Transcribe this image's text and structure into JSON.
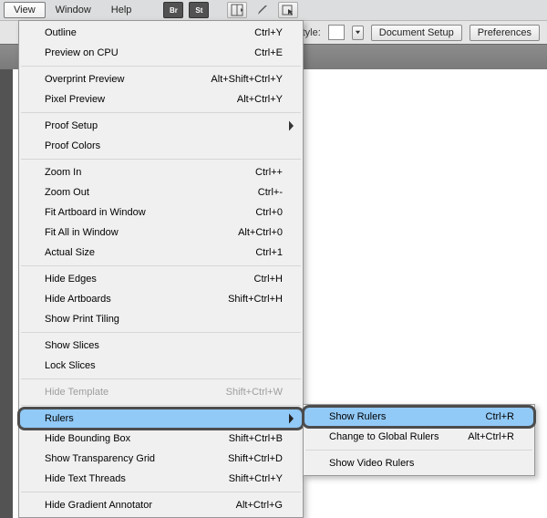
{
  "menubar": {
    "view": "View",
    "window": "Window",
    "help": "Help"
  },
  "second_bar": {
    "style_label": "Style:",
    "doc_setup": "Document Setup",
    "preferences": "Preferences"
  },
  "view_menu": {
    "outline": {
      "label": "Outline",
      "accel": "Ctrl+Y"
    },
    "preview_cpu": {
      "label": "Preview on CPU",
      "accel": "Ctrl+E"
    },
    "overprint_preview": {
      "label": "Overprint Preview",
      "accel": "Alt+Shift+Ctrl+Y"
    },
    "pixel_preview": {
      "label": "Pixel Preview",
      "accel": "Alt+Ctrl+Y"
    },
    "proof_setup": {
      "label": "Proof Setup",
      "accel": ""
    },
    "proof_colors": {
      "label": "Proof Colors",
      "accel": ""
    },
    "zoom_in": {
      "label": "Zoom In",
      "accel": "Ctrl++"
    },
    "zoom_out": {
      "label": "Zoom Out",
      "accel": "Ctrl+-"
    },
    "fit_artboard": {
      "label": "Fit Artboard in Window",
      "accel": "Ctrl+0"
    },
    "fit_all": {
      "label": "Fit All in Window",
      "accel": "Alt+Ctrl+0"
    },
    "actual_size": {
      "label": "Actual Size",
      "accel": "Ctrl+1"
    },
    "hide_edges": {
      "label": "Hide Edges",
      "accel": "Ctrl+H"
    },
    "hide_artboards": {
      "label": "Hide Artboards",
      "accel": "Shift+Ctrl+H"
    },
    "show_print_tiling": {
      "label": "Show Print Tiling",
      "accel": ""
    },
    "show_slices": {
      "label": "Show Slices",
      "accel": ""
    },
    "lock_slices": {
      "label": "Lock Slices",
      "accel": ""
    },
    "hide_template": {
      "label": "Hide Template",
      "accel": "Shift+Ctrl+W"
    },
    "rulers": {
      "label": "Rulers",
      "accel": ""
    },
    "hide_bounding": {
      "label": "Hide Bounding Box",
      "accel": "Shift+Ctrl+B"
    },
    "show_transparency": {
      "label": "Show Transparency Grid",
      "accel": "Shift+Ctrl+D"
    },
    "hide_text_threads": {
      "label": "Hide Text Threads",
      "accel": "Shift+Ctrl+Y"
    },
    "hide_gradient_annot": {
      "label": "Hide Gradient Annotator",
      "accel": "Alt+Ctrl+G"
    }
  },
  "rulers_submenu": {
    "show_rulers": {
      "label": "Show Rulers",
      "accel": "Ctrl+R"
    },
    "change_global": {
      "label": "Change to Global Rulers",
      "accel": "Alt+Ctrl+R"
    },
    "show_video": {
      "label": "Show Video Rulers",
      "accel": ""
    }
  }
}
